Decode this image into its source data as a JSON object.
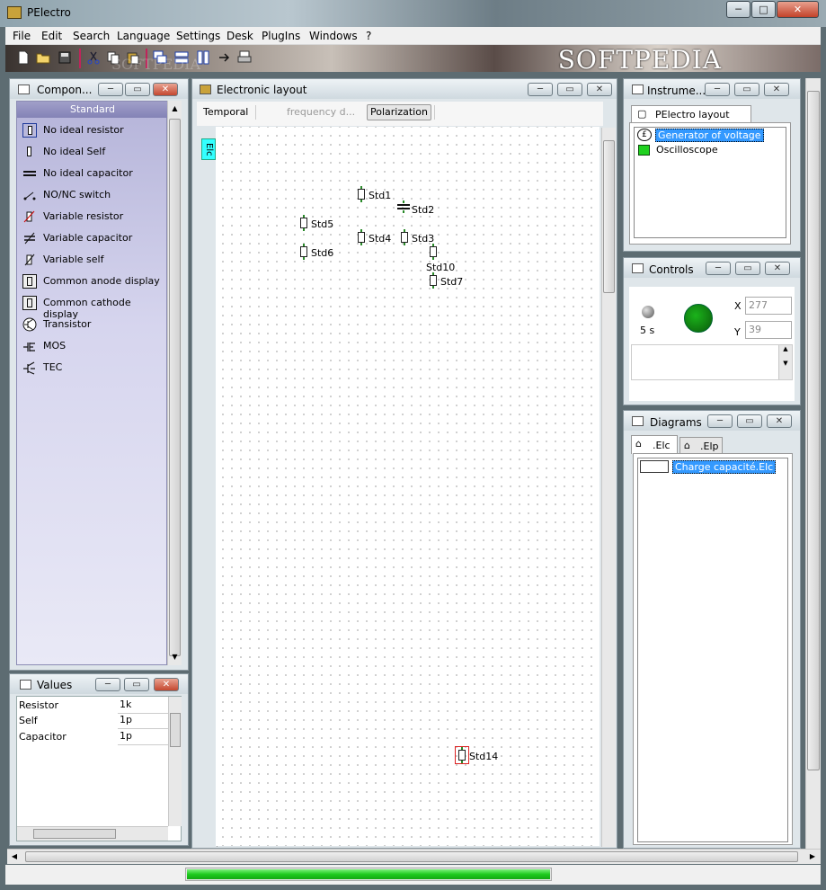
{
  "window": {
    "title": "PElectro",
    "min_glyph": "─",
    "max_glyph": "□",
    "close_glyph": "✕"
  },
  "menu": [
    "File",
    "Edit",
    "Search",
    "Language",
    "Settings",
    "Desk",
    "PlugIns",
    "Windows",
    "?"
  ],
  "toolbar": {
    "banner": "SOFTPEDIA",
    "watermark": "SOFTPEDIA"
  },
  "components_panel": {
    "title": "Compon...",
    "category": "Standard",
    "items": [
      {
        "label": "No ideal resistor",
        "icon": "resistor-icon"
      },
      {
        "label": "No ideal Self",
        "icon": "inductor-icon"
      },
      {
        "label": "No ideal capacitor",
        "icon": "capacitor-icon"
      },
      {
        "label": "NO/NC switch",
        "icon": "switch-icon"
      },
      {
        "label": "Variable resistor",
        "icon": "variable-resistor-icon"
      },
      {
        "label": "Variable capacitor",
        "icon": "variable-capacitor-icon"
      },
      {
        "label": "Variable self",
        "icon": "variable-inductor-icon"
      },
      {
        "label": "Common anode display",
        "icon": "seven-segment-icon"
      },
      {
        "label": "Common cathode display",
        "icon": "seven-segment-icon"
      },
      {
        "label": "Transistor",
        "icon": "transistor-icon"
      },
      {
        "label": "MOS",
        "icon": "mos-icon"
      },
      {
        "label": "TEC",
        "icon": "tec-icon"
      }
    ]
  },
  "values_panel": {
    "title": "Values",
    "rows": [
      {
        "name": "Resistor",
        "value": "1k"
      },
      {
        "name": "Self",
        "value": "1p"
      },
      {
        "name": "Capacitor",
        "value": "1p"
      }
    ]
  },
  "layout_panel": {
    "title": "Electronic layout",
    "tabs": [
      "Temporal",
      "frequency d...",
      "Polarization"
    ],
    "side_tab": "Elc",
    "components": [
      {
        "label": "Std1",
        "kind": "resistor"
      },
      {
        "label": "Std2",
        "kind": "capacitor"
      },
      {
        "label": "Std5",
        "kind": "resistor"
      },
      {
        "label": "Std4",
        "kind": "resistor"
      },
      {
        "label": "Std3",
        "kind": "resistor"
      },
      {
        "label": "Std6",
        "kind": "resistor"
      },
      {
        "label": "Std10",
        "kind": "resistor"
      },
      {
        "label": "Std7",
        "kind": "resistor"
      },
      {
        "label": "Std14",
        "kind": "resistor"
      }
    ]
  },
  "instruments_panel": {
    "title": "Instrume...",
    "tab": "PElectro layout (.Elc)",
    "items": [
      "Generator of voltage",
      "Oscilloscope"
    ]
  },
  "controls_panel": {
    "title": "Controls",
    "time_label": "5 s",
    "x_label": "X",
    "x_value": "277",
    "y_label": "Y",
    "y_value": "39"
  },
  "diagrams_panel": {
    "title": "Diagrams",
    "tabs": [
      ".Elc",
      ".Elp"
    ],
    "items": [
      "Charge capacité.Elc"
    ]
  },
  "colors": {
    "accent_green": "#1fd11f",
    "selection": "#3399ff",
    "side_tab": "#33ffff"
  }
}
